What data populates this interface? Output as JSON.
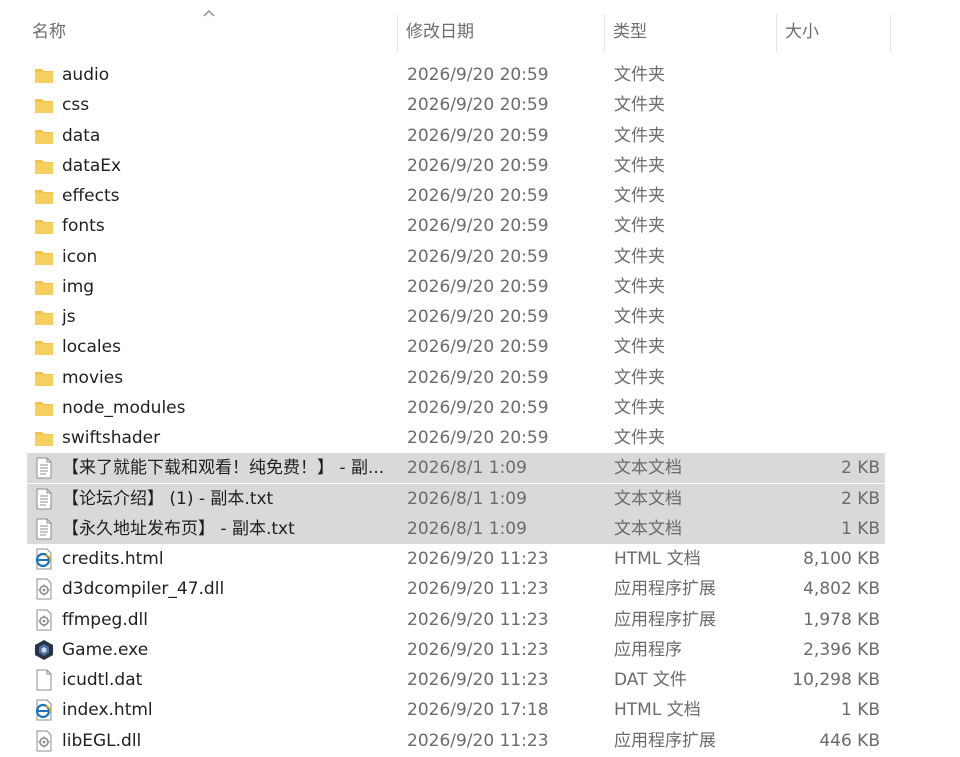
{
  "columns": {
    "name": "名称",
    "modified": "修改日期",
    "type": "类型",
    "size": "大小"
  },
  "files": [
    {
      "name": "audio",
      "date": "2026/9/20 20:59",
      "type": "文件夹",
      "size": "",
      "icon": "folder-icon",
      "selected": false
    },
    {
      "name": "css",
      "date": "2026/9/20 20:59",
      "type": "文件夹",
      "size": "",
      "icon": "folder-icon",
      "selected": false
    },
    {
      "name": "data",
      "date": "2026/9/20 20:59",
      "type": "文件夹",
      "size": "",
      "icon": "folder-icon",
      "selected": false
    },
    {
      "name": "dataEx",
      "date": "2026/9/20 20:59",
      "type": "文件夹",
      "size": "",
      "icon": "folder-icon",
      "selected": false
    },
    {
      "name": "effects",
      "date": "2026/9/20 20:59",
      "type": "文件夹",
      "size": "",
      "icon": "folder-icon",
      "selected": false
    },
    {
      "name": "fonts",
      "date": "2026/9/20 20:59",
      "type": "文件夹",
      "size": "",
      "icon": "folder-icon",
      "selected": false
    },
    {
      "name": "icon",
      "date": "2026/9/20 20:59",
      "type": "文件夹",
      "size": "",
      "icon": "folder-icon",
      "selected": false
    },
    {
      "name": "img",
      "date": "2026/9/20 20:59",
      "type": "文件夹",
      "size": "",
      "icon": "folder-icon",
      "selected": false
    },
    {
      "name": "js",
      "date": "2026/9/20 20:59",
      "type": "文件夹",
      "size": "",
      "icon": "folder-icon",
      "selected": false
    },
    {
      "name": "locales",
      "date": "2026/9/20 20:59",
      "type": "文件夹",
      "size": "",
      "icon": "folder-icon",
      "selected": false
    },
    {
      "name": "movies",
      "date": "2026/9/20 20:59",
      "type": "文件夹",
      "size": "",
      "icon": "folder-icon",
      "selected": false
    },
    {
      "name": "node_modules",
      "date": "2026/9/20 20:59",
      "type": "文件夹",
      "size": "",
      "icon": "folder-icon",
      "selected": false
    },
    {
      "name": "swiftshader",
      "date": "2026/9/20 20:59",
      "type": "文件夹",
      "size": "",
      "icon": "folder-icon",
      "selected": false
    },
    {
      "name": "【来了就能下载和观看！纯免费！】 - 副...",
      "date": "2026/8/1 1:09",
      "type": "文本文档",
      "size": "2 KB",
      "icon": "text-file-icon",
      "selected": true
    },
    {
      "name": "【论坛介绍】 (1) - 副本.txt",
      "date": "2026/8/1 1:09",
      "type": "文本文档",
      "size": "2 KB",
      "icon": "text-file-icon",
      "selected": true
    },
    {
      "name": "【永久地址发布页】 - 副本.txt",
      "date": "2026/8/1 1:09",
      "type": "文本文档",
      "size": "1 KB",
      "icon": "text-file-icon",
      "selected": true
    },
    {
      "name": "credits.html",
      "date": "2026/9/20 11:23",
      "type": "HTML 文档",
      "size": "8,100 KB",
      "icon": "html-file-icon",
      "selected": false
    },
    {
      "name": "d3dcompiler_47.dll",
      "date": "2026/9/20 11:23",
      "type": "应用程序扩展",
      "size": "4,802 KB",
      "icon": "dll-file-icon",
      "selected": false
    },
    {
      "name": "ffmpeg.dll",
      "date": "2026/9/20 11:23",
      "type": "应用程序扩展",
      "size": "1,978 KB",
      "icon": "dll-file-icon",
      "selected": false
    },
    {
      "name": "Game.exe",
      "date": "2026/9/20 11:23",
      "type": "应用程序",
      "size": "2,396 KB",
      "icon": "exe-app-icon",
      "selected": false
    },
    {
      "name": "icudtl.dat",
      "date": "2026/9/20 11:23",
      "type": "DAT 文件",
      "size": "10,298 KB",
      "icon": "blank-file-icon",
      "selected": false
    },
    {
      "name": "index.html",
      "date": "2026/9/20 17:18",
      "type": "HTML 文档",
      "size": "1 KB",
      "icon": "html-file-icon",
      "selected": false
    },
    {
      "name": "libEGL.dll",
      "date": "2026/9/20 11:23",
      "type": "应用程序扩展",
      "size": "446 KB",
      "icon": "dll-file-icon",
      "selected": false
    }
  ],
  "colors": {
    "folder": "#F2C24A",
    "selection": "#D9D9D9",
    "html_icon": "#1E73BE"
  }
}
